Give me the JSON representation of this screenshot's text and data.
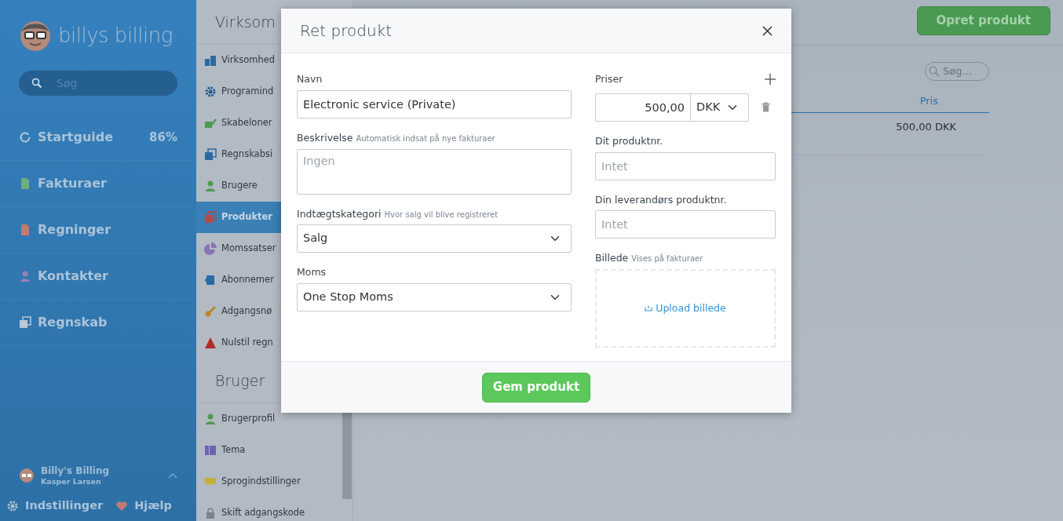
{
  "sidebar": {
    "brand": "billys billing",
    "search": {
      "placeholder": "Søg"
    },
    "items": [
      {
        "label": "Startguide",
        "badge": "86%",
        "kind": "ring",
        "color": "#b8cadb"
      },
      {
        "label": "Fakturaer",
        "kind": "document",
        "color": "#6fae7e"
      },
      {
        "label": "Regninger",
        "kind": "document",
        "color": "#c07b73"
      },
      {
        "label": "Kontakter",
        "kind": "person",
        "color": "#9d7fb5"
      },
      {
        "label": "Regnskab",
        "kind": "squares",
        "color": "#b8c8d6"
      }
    ],
    "user": {
      "company": "Billy's Billing",
      "name": "Kasper Larsen"
    },
    "footer_links": [
      {
        "label": "Indstillinger",
        "kind": "gear",
        "color": "#a8bccb"
      },
      {
        "label": "Hjælp",
        "kind": "heart",
        "color": "#c57a75"
      }
    ]
  },
  "settings_panel": {
    "sections": [
      {
        "title": "Virksom",
        "items": [
          {
            "label": "Virksomhed",
            "kind": "bars",
            "color": "#2a6aa3",
            "selected": false
          },
          {
            "label": "Programind",
            "kind": "gear",
            "color": "#235e94",
            "selected": false
          },
          {
            "label": "Skabeloner",
            "kind": "check",
            "color": "#4d9a55",
            "selected": false
          },
          {
            "label": "Regnskabsi",
            "kind": "squares",
            "color": "#2a6aa3",
            "selected": false
          },
          {
            "label": "Brugere",
            "kind": "person",
            "color": "#4f9a55",
            "selected": false
          },
          {
            "label": "Produkter",
            "kind": "squares",
            "color": "#b44a48",
            "selected": true
          },
          {
            "label": "Momssatser",
            "kind": "pie",
            "color": "#8873b3",
            "selected": false
          },
          {
            "label": "Abonnemer",
            "kind": "puzzle",
            "color": "#2a6aa3",
            "selected": false
          },
          {
            "label": "Adgangsnø",
            "kind": "key",
            "color": "#b98a22",
            "selected": false
          },
          {
            "label": "Nulstil regn",
            "kind": "triangle",
            "color": "#b22a2a",
            "selected": false
          }
        ]
      },
      {
        "title": "Bruger",
        "items": [
          {
            "label": "Brugerprofil",
            "kind": "person",
            "color": "#4f9a55",
            "selected": false
          },
          {
            "label": "Tema",
            "kind": "columns",
            "color": "#6d63b5",
            "selected": false
          },
          {
            "label": "Sprogindstillinger",
            "kind": "speech",
            "color": "#c2b03a",
            "selected": false
          },
          {
            "label": "Skift adgangskode",
            "kind": "lock",
            "color": "#7b828b",
            "selected": false
          }
        ]
      }
    ]
  },
  "main": {
    "create_button": "Opret produkt",
    "search": {
      "placeholder": "Søg..."
    },
    "table": {
      "columns": [
        "Pris"
      ],
      "rows": [
        [
          "500,00 DKK"
        ]
      ]
    }
  },
  "modal": {
    "title": "Ret produkt",
    "name": {
      "label": "Navn",
      "value": "Electronic service (Private)"
    },
    "description": {
      "label": "Beskrivelse",
      "hint": "Automatisk indsat på nye fakturaer",
      "placeholder": "Ingen"
    },
    "income_category": {
      "label": "Indtægtskategori",
      "hint": "Hvor salg vil blive registreret",
      "value": "Salg"
    },
    "vat": {
      "label": "Moms",
      "value": "One Stop Moms"
    },
    "prices": {
      "label": "Priser",
      "amount": "500,00",
      "currency": "DKK"
    },
    "product_no": {
      "label": "Dit produktnr.",
      "placeholder": "Intet"
    },
    "supplier_product_no": {
      "label": "Din leverandørs produktnr.",
      "placeholder": "Intet"
    },
    "image": {
      "label": "Billede",
      "hint": "Vises på fakturaer",
      "upload": "Upload billede"
    },
    "save_button": "Gem produkt"
  }
}
